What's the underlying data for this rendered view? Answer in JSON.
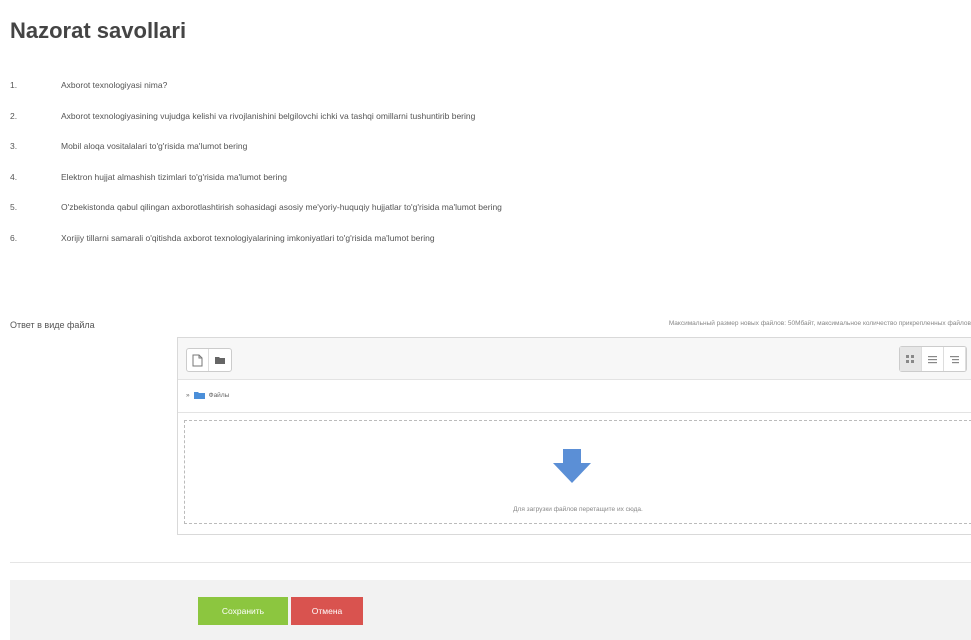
{
  "title": "Nazorat savollari",
  "questions": [
    {
      "num": "1.",
      "text": "Axborot texnologiyasi nima?"
    },
    {
      "num": "2.",
      "text": "Axborot texnologiyasining vujudga kelishi va rivojlanishini belgilovchi ichki va tashqi omillarni tushuntirib bering"
    },
    {
      "num": "3.",
      "text": "Mobil aloqa vositalalari to'g'risida ma'lumot bering"
    },
    {
      "num": "4.",
      "text": "Elektron hujjat almashish tizimlari to'g'risida ma'lumot bering"
    },
    {
      "num": "5.",
      "text": "O'zbekistonda qabul qilingan axborotlashtirish sohasidagi asosiy me'yoriy-huquqiy hujjatlar to'g'risida ma'lumot bering"
    },
    {
      "num": "6.",
      "text": "Xorijiy tillarni samarali o'qitishda axborot texnologiyalarining imkoniyatlari to'g'risida ma'lumot bering"
    }
  ],
  "file_field": {
    "label": "Ответ в виде файла",
    "limit_note": "Максимальный размер новых файлов: 50Мбайт, максимальное количество прикрепленных файлов"
  },
  "filemanager": {
    "path_label": "Файлы",
    "drop_text": "Для загрузки файлов перетащите их сюда."
  },
  "buttons": {
    "save": "Сохранить",
    "cancel": "Отмена"
  },
  "colors": {
    "save": "#8cc63f",
    "cancel": "#d9534f",
    "arrow": "#5b8fd6"
  }
}
